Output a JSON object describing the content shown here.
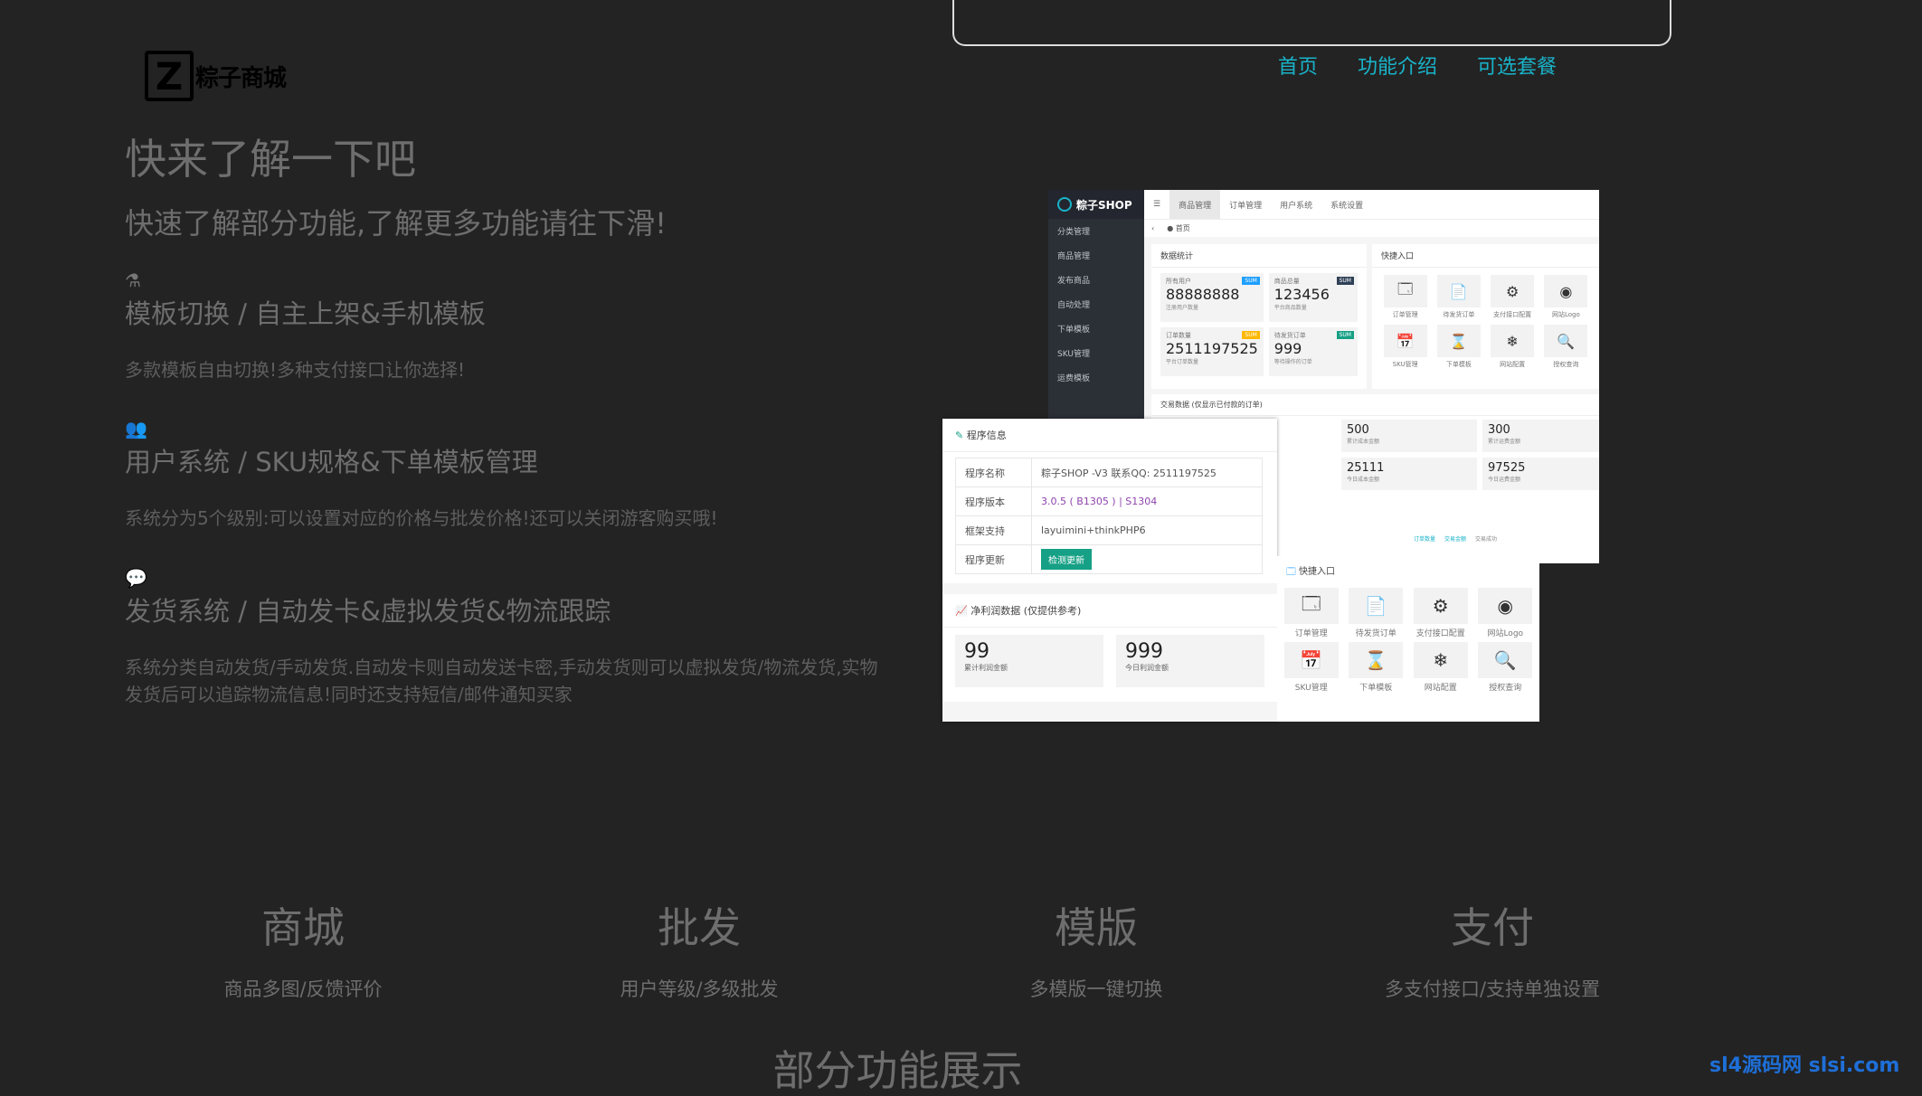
{
  "nav": {
    "items": [
      "首页",
      "功能介绍",
      "可选套餐"
    ]
  },
  "logo": {
    "letter": "Z",
    "text": "粽子商城"
  },
  "intro": {
    "title": "快来了解一下吧",
    "subtitle": "快速了解部分功能,了解更多功能请往下滑!"
  },
  "features": [
    {
      "icon": "⚗",
      "title": "模板切换 / 自主上架&手机模板",
      "desc": "多款模板自由切换!多种支付接口让你选择!"
    },
    {
      "icon": "👥",
      "title": "用户系统 / SKU规格&下单模板管理",
      "desc": "系统分为5个级别:可以设置对应的价格与批发价格!还可以关闭游客购买哦!"
    },
    {
      "icon": "💬",
      "title": "发货系统 / 自动发卡&虚拟发货&物流跟踪",
      "desc": "系统分类自动发货/手动发货.自动发卡则自动发送卡密,手动发货则可以虚拟发货/物流发货,实物发货后可以追踪物流信息!同时还支持短信/邮件通知买家"
    }
  ],
  "admin": {
    "brand": "粽子SHOP",
    "menu": [
      "分类管理",
      "商品管理",
      "发布商品",
      "自动处理",
      "下单模板",
      "SKU管理",
      "运费模板"
    ],
    "tabs": [
      "☰",
      "商品管理",
      "订单管理",
      "用户系统",
      "系统设置"
    ],
    "crumb": [
      "‹",
      "● 首页"
    ],
    "stats_title": "数据统计",
    "stats": [
      {
        "label": "所有用户",
        "value": "88888888",
        "sub": "注册用户数量",
        "tag": "SUM",
        "tag_color": "#1e9fff"
      },
      {
        "label": "商品总量",
        "value": "123456",
        "sub": "平台商品数量",
        "tag": "SUM",
        "tag_color": "#2f4056"
      },
      {
        "label": "订单数量",
        "value": "2511197525",
        "sub": "平台订单数量",
        "tag": "SUM",
        "tag_color": "#ffb800"
      },
      {
        "label": "待发货订单",
        "value": "999",
        "sub": "等待操作的订单",
        "tag": "SUM",
        "tag_color": "#16a085"
      }
    ],
    "quick_title": "快捷入口",
    "quick": [
      {
        "icon": "🗔",
        "label": "订单管理"
      },
      {
        "icon": "📄",
        "label": "待发货订单"
      },
      {
        "icon": "⚙",
        "label": "支付接口配置"
      },
      {
        "icon": "◉",
        "label": "网站Logo"
      },
      {
        "icon": "📅",
        "label": "SKU管理"
      },
      {
        "icon": "⌛",
        "label": "下单模板"
      },
      {
        "icon": "❄",
        "label": "网站配置"
      },
      {
        "icon": "🔍",
        "label": "授权查询"
      }
    ],
    "trade_title": "交易数据 (仅显示已付款的订单)",
    "trade": [
      {
        "value": "500",
        "sub": "累计成本金额"
      },
      {
        "value": "300",
        "sub": "累计运费金额"
      },
      {
        "value": "25111",
        "sub": "今日成本金额"
      },
      {
        "value": "97525",
        "sub": "今日运费金额"
      }
    ],
    "legend": [
      "订单数量",
      "交易金额",
      "交易成功"
    ]
  },
  "program": {
    "title": "程序信息",
    "rows": [
      {
        "key": "程序名称",
        "value": "粽子SHOP -V3 联系QQ: 2511197525"
      },
      {
        "key": "程序版本",
        "value": "3.0.5 ( B1305 ) | S1304"
      },
      {
        "key": "框架支持",
        "value": "layuimini+thinkPHP6"
      },
      {
        "key": "程序更新",
        "value": "检测更新"
      }
    ],
    "profit_title": "净利润数据 (仅提供参考)",
    "profit": [
      {
        "value": "99",
        "sub": "累计利润金额"
      },
      {
        "value": "999",
        "sub": "今日利润金额"
      }
    ]
  },
  "categories": [
    {
      "title": "商城",
      "desc": "商品多图/反馈评价"
    },
    {
      "title": "批发",
      "desc": "用户等级/多级批发"
    },
    {
      "title": "模版",
      "desc": "多模版一键切换"
    },
    {
      "title": "支付",
      "desc": "多支付接口/支持单独设置"
    }
  ],
  "bottom_title": "部分功能展示",
  "watermark": "sl4源码网 slsi.com"
}
